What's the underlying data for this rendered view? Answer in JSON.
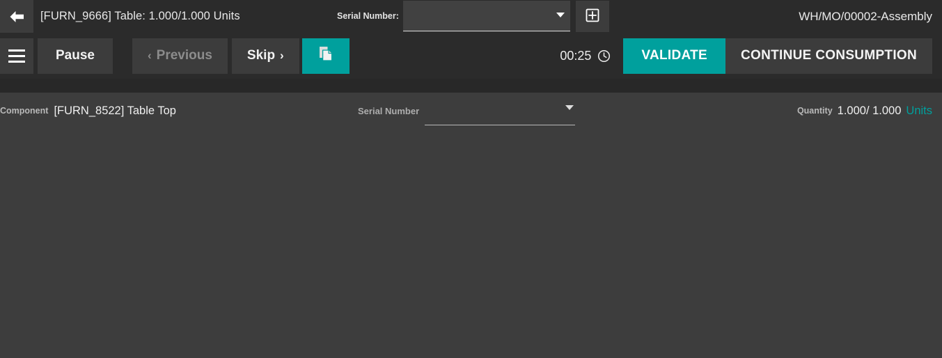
{
  "header": {
    "back_icon": "arrow-left-icon",
    "title": "[FURN_9666] Table: 1.000/1.000 Units",
    "serial_label": "Serial Number:",
    "serial_value": "",
    "serial_placeholder": "",
    "add_icon": "square-plus-icon",
    "reference": "WH/MO/00002-Assembly"
  },
  "toolbar": {
    "menu_icon": "hamburger-menu-icon",
    "pause_label": "Pause",
    "previous_label": "Previous",
    "previous_chevron": "‹",
    "skip_label": "Skip",
    "skip_chevron": "›",
    "duplicate_icon": "copy-documents-icon",
    "timer_value": "00:25",
    "timer_icon": "clock-icon",
    "validate_label": "VALIDATE",
    "continue_label": "CONTINUE CONSUMPTION"
  },
  "component": {
    "label": "Component",
    "name": "[FURN_8522] Table Top",
    "serial_label": "Serial Number",
    "serial_value": "",
    "serial_placeholder": "",
    "quantity_label": "Quantity",
    "quantity_value": "1.000/ 1.000",
    "quantity_uom": "Units"
  },
  "colors": {
    "accent_teal": "#00a09d",
    "header_bg": "#2b2b2b",
    "body_bg": "#3d3d3d",
    "button_bg": "#3c3c3c",
    "divider_bg": "#282828",
    "disabled_text": "#8c8c8c"
  }
}
